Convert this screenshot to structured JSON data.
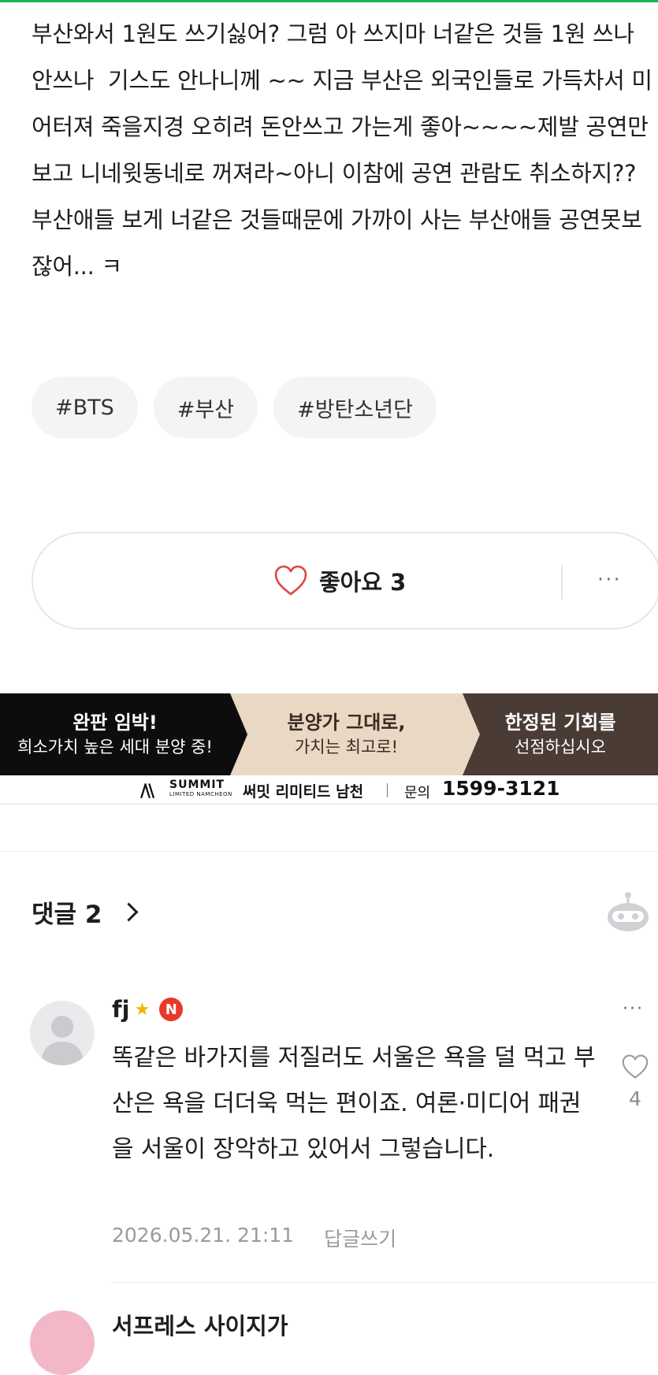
{
  "post": {
    "text": "부산와서 1원도 쓰기싫어? 그럼 아 쓰지마 너같은 것들 1원 쓰나 안쓰나  기스도 안나니께 ~~ 지금 부산은 외국인들로 가득차서 미어터져 죽을지경 오히려 돈안쓰고 가는게 좋아~~~~제발 공연만 보고 니네윗동네로 꺼져라~아니 이참에 공연 관람도 취소하지?? 부산애들 보게 너같은 것들때문에 가까이 사는 부산애들 공연못보잖어... ㅋ"
  },
  "tags": [
    "#BTS",
    "#부산",
    "#방탄소년단"
  ],
  "like_bar": {
    "label": "좋아요 3",
    "more": "···"
  },
  "ad": {
    "panel1_title": "완판 임박!",
    "panel1_sub": "희소가치 높은 세대 분양 중!",
    "panel2_title": "분양가 그대로,",
    "panel2_sub": "가치는 최고로!",
    "panel3_title": "한정된 기회를",
    "panel3_sub": "선점하십시오",
    "logo_mark": "/\\\\",
    "logo_text": "SUMMIT",
    "logo_sub": "LIMITED NAMCHEON",
    "brand_name": "써밋 리미티드 남천",
    "contact_label": "문의",
    "phone": "1599-3121"
  },
  "comments": {
    "header": "댓글 2",
    "items": [
      {
        "author": "fj",
        "badge": "N",
        "text": "똑같은 바가지를 저질러도 서울은 욕을 덜 먹고 부산은 욕을 더더욱 먹는 편이죠. 여론·미디어 패권을 서울이 장악하고 있어서 그렇습니다.",
        "timestamp": "2026.05.21. 21:11",
        "reply_label": "답글쓰기",
        "like_count": "4",
        "more": "···"
      }
    ],
    "next_author_partial": "서프레스 사이지가"
  },
  "colors": {
    "accent_green": "#1db155",
    "heart_red": "#d94848",
    "badge_red": "#e83a2b",
    "tag_bg": "#f3f4f5"
  },
  "icons": [
    "heart-icon",
    "more-dots-icon",
    "chevron-right-icon",
    "bot-icon",
    "star-icon",
    "n-badge-icon",
    "heart-outline-icon"
  ]
}
